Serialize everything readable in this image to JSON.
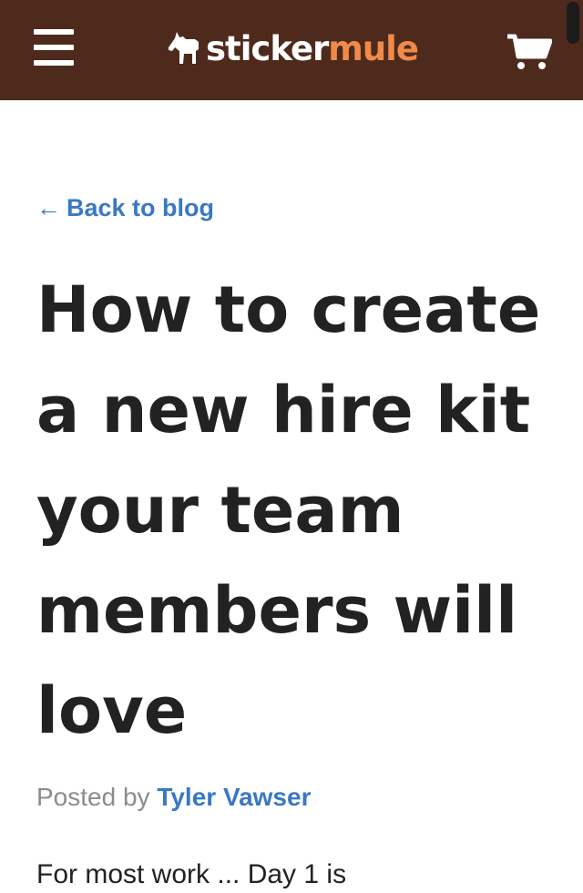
{
  "header": {
    "logo_text_white": "sticker",
    "logo_text_orange": "mule",
    "menu_icon": "hamburger-menu-icon",
    "logo_icon": "mule-icon",
    "cart_icon": "shopping-cart-icon",
    "colors": {
      "background": "#4e2a1c",
      "logo_accent": "#f08a4b"
    }
  },
  "nav": {
    "back_arrow": "←",
    "back_label": "Back to blog"
  },
  "article": {
    "title": "How to create a new hire kit your team members will love",
    "byline_prefix": "Posted by",
    "author": "Tyler Vawser",
    "intro_fragment": "For most work ... Day 1 is"
  },
  "colors": {
    "link": "#3a78c3",
    "heading": "#222222",
    "muted": "#8c8c8c"
  }
}
